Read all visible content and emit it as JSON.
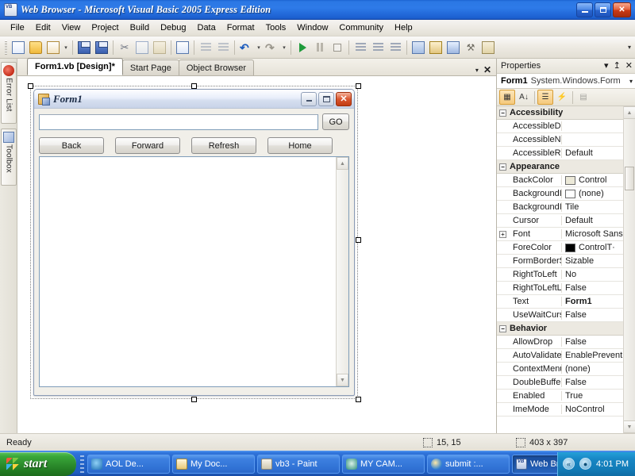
{
  "window": {
    "title": "Web Browser - Microsoft Visual Basic 2005 Express Edition",
    "app_icon": "vb-logo-icon",
    "minimize_label": "Minimize",
    "restore_label": "Restore",
    "close_label": "Close"
  },
  "menu": {
    "items": [
      {
        "label": "File"
      },
      {
        "label": "Edit"
      },
      {
        "label": "View"
      },
      {
        "label": "Project"
      },
      {
        "label": "Build"
      },
      {
        "label": "Debug"
      },
      {
        "label": "Data"
      },
      {
        "label": "Format"
      },
      {
        "label": "Tools"
      },
      {
        "label": "Window"
      },
      {
        "label": "Community"
      },
      {
        "label": "Help"
      }
    ]
  },
  "toolbar": {
    "overflow_label": "»",
    "buttons": [
      {
        "name": "new-project-icon",
        "glyph": ""
      },
      {
        "name": "open-file-icon",
        "glyph": ""
      },
      {
        "name": "add-new-item-icon",
        "glyph": ""
      },
      {
        "name": "add-item-dropdown-icon",
        "glyph": "▾"
      },
      {
        "name": "save-icon",
        "glyph": ""
      },
      {
        "name": "save-all-icon",
        "glyph": ""
      },
      {
        "name": "cut-icon",
        "glyph": "✂"
      },
      {
        "name": "copy-icon",
        "glyph": "❐"
      },
      {
        "name": "paste-icon",
        "glyph": "▤"
      },
      {
        "name": "find-icon",
        "glyph": "⌕"
      },
      {
        "name": "comment-icon",
        "glyph": "≡"
      },
      {
        "name": "uncomment-icon",
        "glyph": "≡"
      },
      {
        "name": "undo-icon",
        "glyph": "↶"
      },
      {
        "name": "undo-dropdown-icon",
        "glyph": "▾"
      },
      {
        "name": "redo-icon",
        "glyph": "↷"
      },
      {
        "name": "redo-dropdown-icon",
        "glyph": "▾"
      },
      {
        "name": "start-debugging-icon",
        "glyph": "▶"
      },
      {
        "name": "pause-icon",
        "glyph": "‖"
      },
      {
        "name": "stop-icon",
        "glyph": "■"
      },
      {
        "name": "step-into-icon",
        "glyph": "↓"
      },
      {
        "name": "step-over-icon",
        "glyph": "→"
      },
      {
        "name": "step-out-icon",
        "glyph": "↑"
      },
      {
        "name": "solution-explorer-icon",
        "glyph": ""
      },
      {
        "name": "properties-window-icon",
        "glyph": ""
      },
      {
        "name": "object-browser-icon",
        "glyph": ""
      },
      {
        "name": "toolbox-icon",
        "glyph": ""
      },
      {
        "name": "error-list-icon",
        "glyph": ""
      }
    ]
  },
  "left_dock": {
    "tabs": [
      {
        "label": "Error List",
        "icon": "error-list-icon"
      },
      {
        "label": "Toolbox",
        "icon": "toolbox-icon"
      }
    ]
  },
  "document_tabs": {
    "tabs": [
      {
        "label": "Form1.vb [Design]*",
        "active": true
      },
      {
        "label": "Start Page",
        "active": false
      },
      {
        "label": "Object Browser",
        "active": false
      }
    ],
    "dropdown_glyph": "▾",
    "close_glyph": "✕"
  },
  "form_designer": {
    "form": {
      "title": "Form1",
      "icon": "vb-form-icon",
      "minimize_glyph": "",
      "maximize_glyph": "",
      "close_glyph": "✕"
    },
    "address_bar": {
      "value": "",
      "placeholder": ""
    },
    "go_button": "GO",
    "nav_buttons": [
      {
        "label": "Back"
      },
      {
        "label": "Forward"
      },
      {
        "label": "Refresh"
      },
      {
        "label": "Home"
      }
    ],
    "browser_pane": {
      "scroll_up_glyph": "▲",
      "scroll_down_glyph": "▼"
    }
  },
  "properties_panel": {
    "title": "Properties",
    "dropdown_glyph": "▾",
    "pin_glyph": "↥",
    "close_glyph": "✕",
    "object_name": "Form1",
    "object_type": "System.Windows.Form",
    "object_caret": "▾",
    "toolbar": [
      {
        "name": "categorized-view-button",
        "glyph": "☷",
        "active": true
      },
      {
        "name": "alphabetical-view-button",
        "glyph": "A↓",
        "active": false
      },
      {
        "name": "properties-button",
        "glyph": "☰",
        "active": true
      },
      {
        "name": "events-button",
        "glyph": "⚡",
        "active": false
      },
      {
        "name": "property-pages-button",
        "glyph": "▤",
        "active": false
      }
    ],
    "scroll_up_glyph": "▲",
    "scroll_down_glyph": "▼",
    "categories": [
      {
        "name": "Accessibility",
        "expander": "−",
        "rows": [
          {
            "name": "AccessibleDe:",
            "value": "",
            "swatch": null,
            "bold": false
          },
          {
            "name": "AccessibleNa",
            "value": "",
            "swatch": null,
            "bold": false
          },
          {
            "name": "AccessibleRol",
            "value": "Default",
            "swatch": null,
            "bold": false
          }
        ]
      },
      {
        "name": "Appearance",
        "expander": "−",
        "rows": [
          {
            "name": "BackColor",
            "value": "Control",
            "swatch": "#ece9d8",
            "bold": false
          },
          {
            "name": "BackgroundIr",
            "value": "(none)",
            "swatch": "#ffffff",
            "bold": false
          },
          {
            "name": "BackgroundIr",
            "value": "Tile",
            "swatch": null,
            "bold": false
          },
          {
            "name": "Cursor",
            "value": "Default",
            "swatch": null,
            "bold": false
          },
          {
            "name": "Font",
            "value": "Microsoft Sans",
            "swatch": null,
            "bold": false,
            "expander": "+"
          },
          {
            "name": "ForeColor",
            "value": "ControlT·",
            "swatch": "#000000",
            "bold": false
          },
          {
            "name": "FormBorderS",
            "value": "Sizable",
            "swatch": null,
            "bold": false
          },
          {
            "name": "RightToLeft",
            "value": "No",
            "swatch": null,
            "bold": false
          },
          {
            "name": "RightToLeftLä",
            "value": "False",
            "swatch": null,
            "bold": false
          },
          {
            "name": "Text",
            "value": "Form1",
            "swatch": null,
            "bold": true
          },
          {
            "name": "UseWaitCurs·",
            "value": "False",
            "swatch": null,
            "bold": false
          }
        ]
      },
      {
        "name": "Behavior",
        "expander": "−",
        "rows": [
          {
            "name": "AllowDrop",
            "value": "False",
            "swatch": null,
            "bold": false
          },
          {
            "name": "AutoValidate",
            "value": "EnablePrevent",
            "swatch": null,
            "bold": false
          },
          {
            "name": "ContextMenu",
            "value": "(none)",
            "swatch": null,
            "bold": false
          },
          {
            "name": "DoubleBuffer",
            "value": "False",
            "swatch": null,
            "bold": false
          },
          {
            "name": "Enabled",
            "value": "True",
            "swatch": null,
            "bold": false
          },
          {
            "name": "ImeMode",
            "value": "NoControl",
            "swatch": null,
            "bold": false
          }
        ]
      }
    ]
  },
  "status_bar": {
    "state": "Ready",
    "cursor_position": "15, 15",
    "selection_size": "403 x 397"
  },
  "taskbar": {
    "start_label": "start",
    "tasks": [
      {
        "label": "AOL De...",
        "icon": "aol-icon",
        "active": false,
        "class": "aol"
      },
      {
        "label": "My Doc...",
        "icon": "folder-icon",
        "active": false,
        "class": "docs"
      },
      {
        "label": "vb3 - Paint",
        "icon": "paint-icon",
        "active": false,
        "class": "paint"
      },
      {
        "label": "MY CAM...",
        "icon": "camera-icon",
        "active": false,
        "class": "cam"
      },
      {
        "label": "submit :...",
        "icon": "internet-explorer-icon",
        "active": false,
        "class": "ie"
      },
      {
        "label": "Web Br...",
        "icon": "vb-icon",
        "active": true,
        "class": "vb"
      }
    ],
    "tray_icons": [
      {
        "name": "show-hidden-icons-button",
        "glyph": "«"
      },
      {
        "name": "volume-icon",
        "glyph": "●"
      }
    ],
    "clock": "4:01 PM"
  },
  "colors": {
    "titlebar_blue": "#2b78e4",
    "taskbar_blue": "#2263c9",
    "start_green": "#2d8e2d",
    "close_red": "#cc3a16",
    "accent_orange": "#f5c97c"
  }
}
